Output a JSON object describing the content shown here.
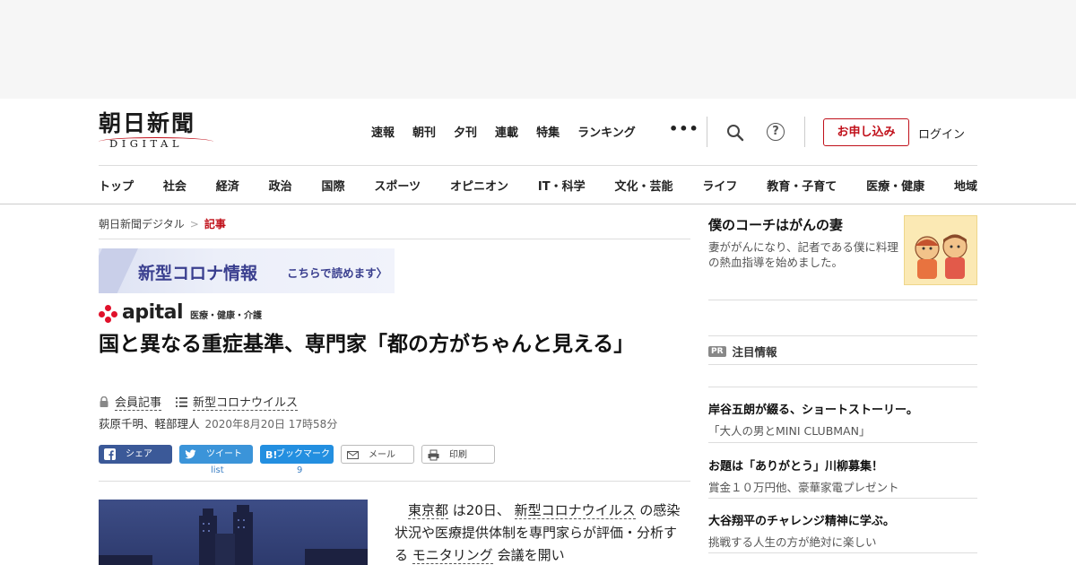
{
  "logo": {
    "ja": "朝日新聞",
    "en": "DIGITAL"
  },
  "topnav": [
    "速報",
    "朝刊",
    "夕刊",
    "連載",
    "特集",
    "ランキング"
  ],
  "more_label": "•••",
  "header_actions": {
    "apply_label": "お申し込み",
    "login_label": "ログイン",
    "help_glyph": "?"
  },
  "catnav": [
    "トップ",
    "社会",
    "経済",
    "政治",
    "国際",
    "スポーツ",
    "オピニオン",
    "IT・科学",
    "文化・芸能",
    "ライフ",
    "教育・子育て",
    "医療・健康",
    "地域"
  ],
  "breadcrumb": {
    "home": "朝日新聞デジタル",
    "sep": ">",
    "current": "記事"
  },
  "corona_banner": {
    "title": "新型コロナ情報",
    "link": "こちらで読めます〉"
  },
  "apital": {
    "word": "apital",
    "sub": "医療・健康・介護"
  },
  "article": {
    "headline": "国と異なる重症基準、専門家「都の方がちゃんと見える」",
    "member_label": "会員記事",
    "topic_label": "新型コロナウイルス",
    "authors": "荻原千明、軽部理人",
    "date": "2020年8月20日 17時58分",
    "body_parts": [
      "東京都",
      " は20日、 ",
      "新型コロナウイルス",
      " の感染状況や医療提供体制を専門家らが評価・分析する ",
      "モニタリング",
      " 会議を開い"
    ]
  },
  "share": {
    "facebook": "シェア",
    "twitter": "ツイート",
    "twitter_count": "list",
    "hatena": "ブックマーク",
    "hatena_count": "9",
    "mail": "メール",
    "print": "印刷"
  },
  "sidebar": {
    "feature": {
      "title": "僕のコーチはがんの妻",
      "desc": "妻ががんになり、記者である僕に料理の熱血指導を始めました。"
    },
    "pr_label": "PR",
    "pr_heading": "注目情報",
    "pr_items": [
      {
        "title": "岸谷五朗が綴る、ショートストーリー。",
        "sub": "「大人の男とMINI CLUBMAN」"
      },
      {
        "title": "お題は「ありがとう」川柳募集！",
        "sub": "賞金１０万円他、豪華家電プレゼント"
      },
      {
        "title": "大谷翔平のチャレンジ精神に学ぶ。",
        "sub": "挑戦する人生の方が絶対に楽しい"
      }
    ]
  },
  "colors": {
    "brand_red": "#c0101a",
    "facebook": "#3b5998",
    "twitter": "#3b94d9",
    "hatena": "#238fe0",
    "apital_red": "#e0102a"
  }
}
